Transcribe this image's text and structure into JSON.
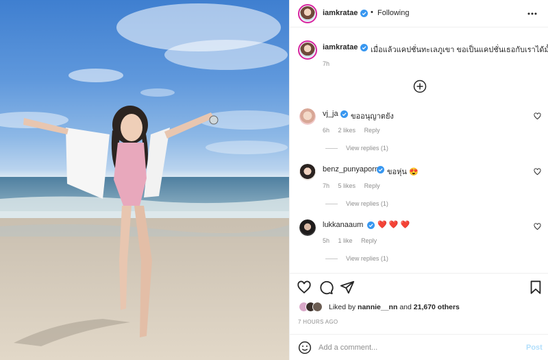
{
  "post": {
    "author": "iamkratae",
    "follow_status": "Following",
    "separator": "•",
    "caption": "เมื่อแล้วแคปชั่นทะเลภูเขา ขอเป็นแคปชั่นเธอกับเราได้มั้ย",
    "caption_time": "7h",
    "more_icon": "more-horizontal-icon",
    "load_more_icon": "plus-circle-icon"
  },
  "comments": [
    {
      "user": "vj_ja",
      "text": "ขออนุญาตยัง",
      "time": "6h",
      "likes": "2 likes",
      "reply": "Reply",
      "view_replies": "View replies (1)"
    },
    {
      "user": "benz_punyaporn",
      "text": "ขอหุ่น 😍",
      "time": "7h",
      "likes": "5 likes",
      "reply": "Reply",
      "view_replies": "View replies (1)"
    },
    {
      "user": "lukkanaaum",
      "text": "❤️ ❤️ ❤️",
      "time": "5h",
      "likes": "1 like",
      "reply": "Reply",
      "view_replies": "View replies (1)"
    }
  ],
  "actions": {
    "like_icon": "heart-icon",
    "comment_icon": "comment-icon",
    "share_icon": "send-icon",
    "save_icon": "bookmark-icon"
  },
  "likes": {
    "prefix": "Liked by",
    "user": "nannie__nn",
    "middle": "and",
    "others": "21,670 others"
  },
  "time_ago": "7 HOURS AGO",
  "add_comment": {
    "placeholder": "Add a comment...",
    "post_label": "Post",
    "emoji_icon": "smiley-icon"
  },
  "colors": {
    "verified": "#3897f0",
    "ring": "#d6249f",
    "text": "#262626",
    "muted": "#8e8e8e",
    "post_disabled": "#b2dffc"
  }
}
